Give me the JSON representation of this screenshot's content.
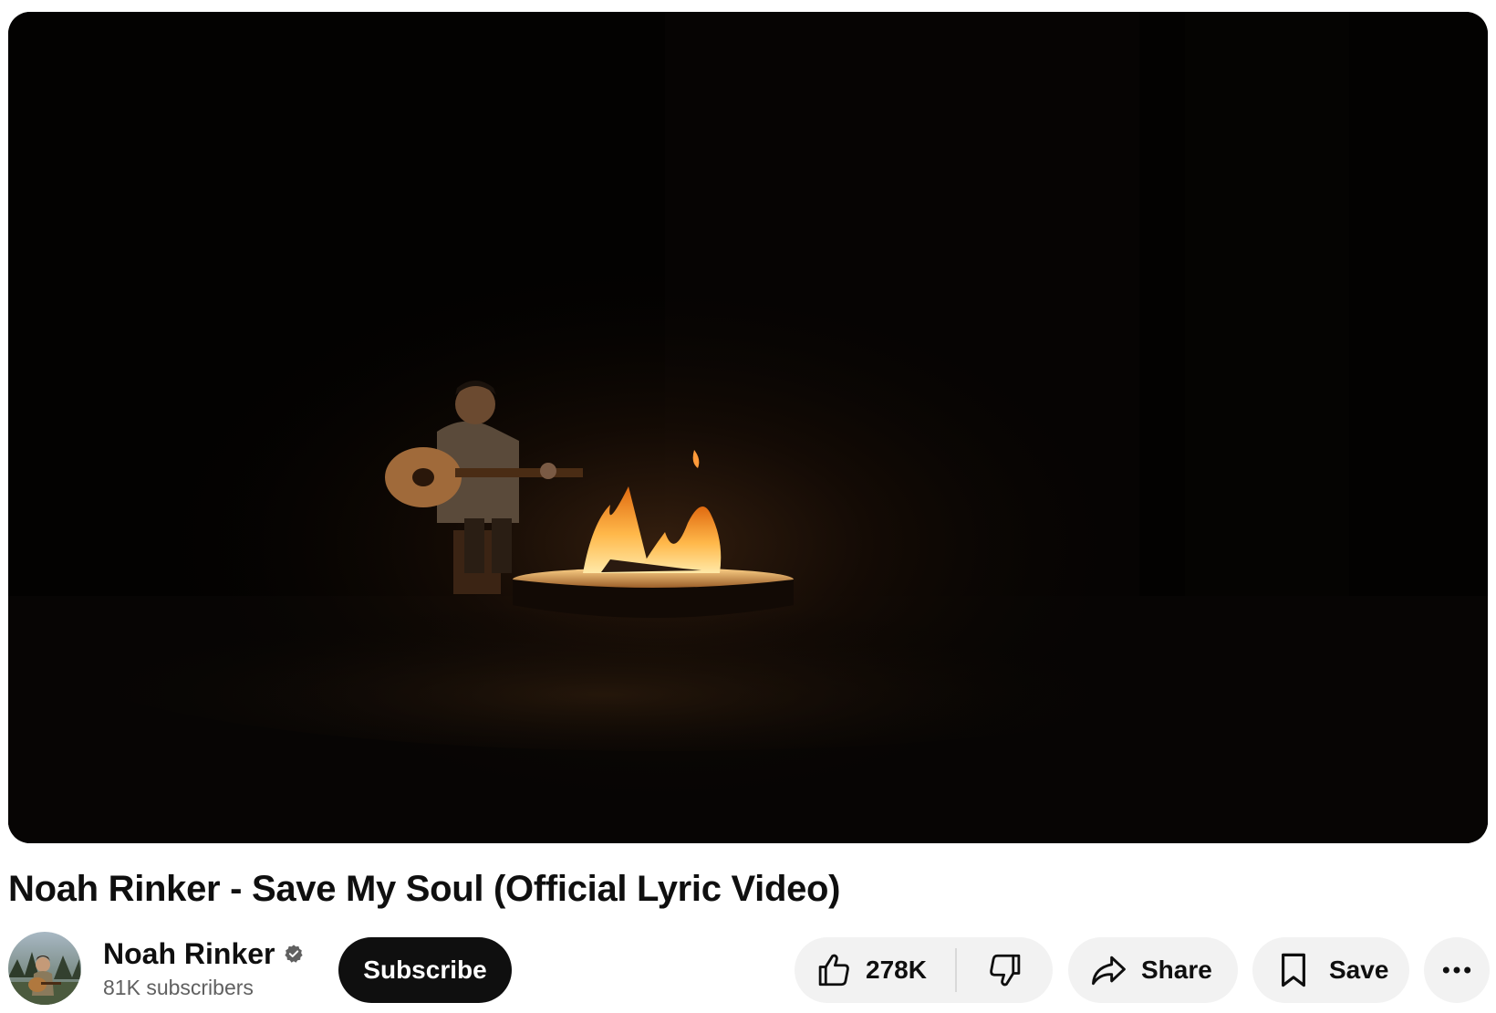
{
  "video": {
    "title": "Noah Rinker - Save My Soul (Official Lyric Video)"
  },
  "channel": {
    "name": "Noah Rinker",
    "subscribers": "81K subscribers",
    "verified": true,
    "avatar_icon": "channel-avatar"
  },
  "actions": {
    "subscribe_label": "Subscribe",
    "like_count": "278K",
    "like_icon": "thumbs-up-icon",
    "dislike_icon": "thumbs-down-icon",
    "share_label": "Share",
    "share_icon": "share-arrow-icon",
    "save_label": "Save",
    "save_icon": "bookmark-icon",
    "more_icon": "more-horizontal-icon"
  },
  "colors": {
    "subscribe_bg": "#0f0f0f",
    "pill_bg": "#f2f2f2",
    "text_primary": "#0f0f0f",
    "text_secondary": "#606060"
  }
}
